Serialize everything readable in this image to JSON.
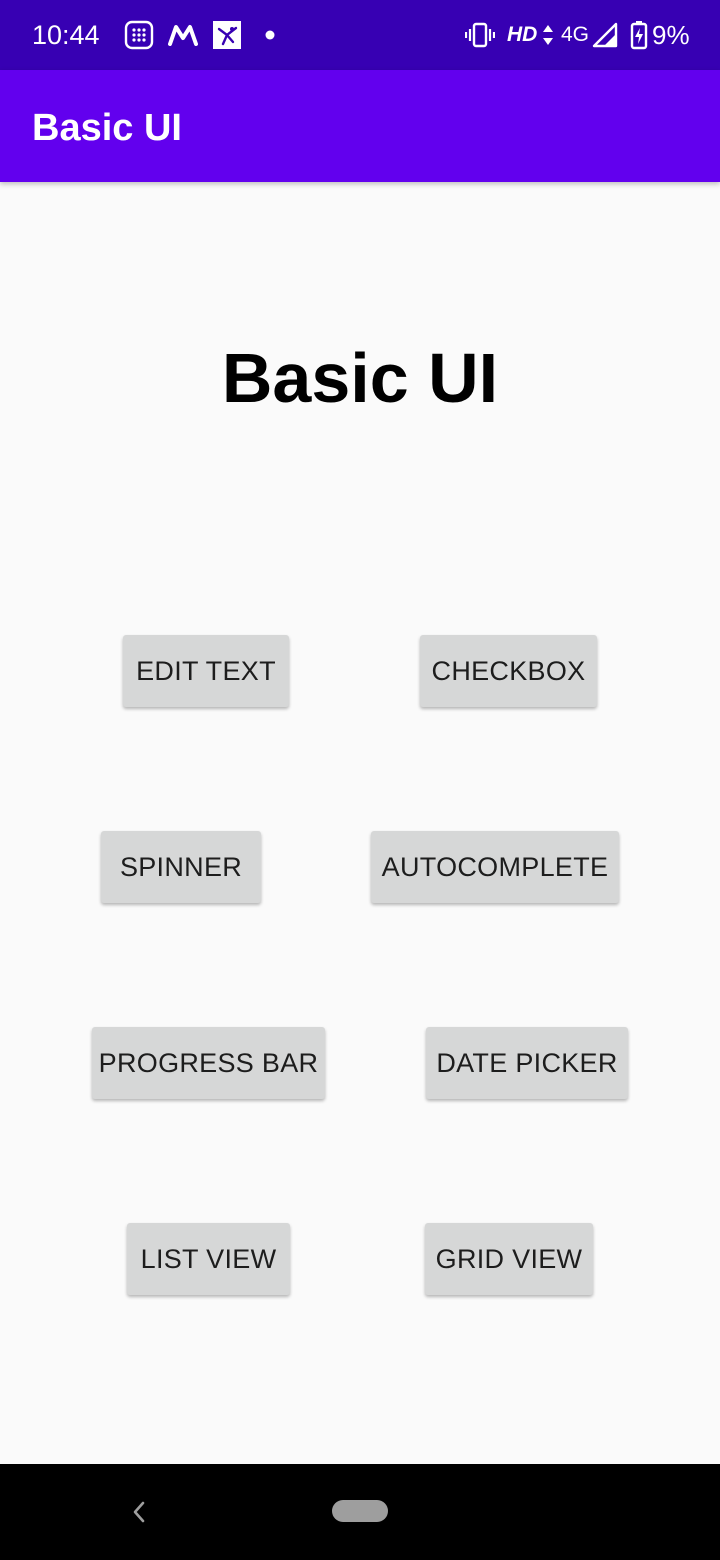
{
  "status_bar": {
    "time": "10:44",
    "network_type": "HD",
    "signal_label": "4G",
    "battery": "9%",
    "icons": [
      "calendar-grid-icon",
      "myntra-m-icon",
      "photo-app-icon",
      "notification-dot-icon",
      "vibrate-icon",
      "data-arrows-icon",
      "cell-signal-icon",
      "battery-charging-icon"
    ]
  },
  "app_bar": {
    "title": "Basic UI"
  },
  "main": {
    "heading": "Basic UI",
    "buttons": {
      "edit_text": "EDIT TEXT",
      "checkbox": "CHECKBOX",
      "spinner": "SPINNER",
      "autocomplete": "AUTOCOMPLETE",
      "progress_bar": "PROGRESS BAR",
      "date_picker": "DATE PICKER",
      "list_view": "LIST VIEW",
      "grid_view": "GRID VIEW"
    }
  },
  "nav_bar": {
    "icons": [
      "back-chevron-icon",
      "home-pill-icon"
    ]
  },
  "colors": {
    "status_bar": "#3700b3",
    "app_bar": "#6200ee",
    "background": "#fafafa",
    "button": "#d6d7d7",
    "nav_bar": "#000000"
  }
}
